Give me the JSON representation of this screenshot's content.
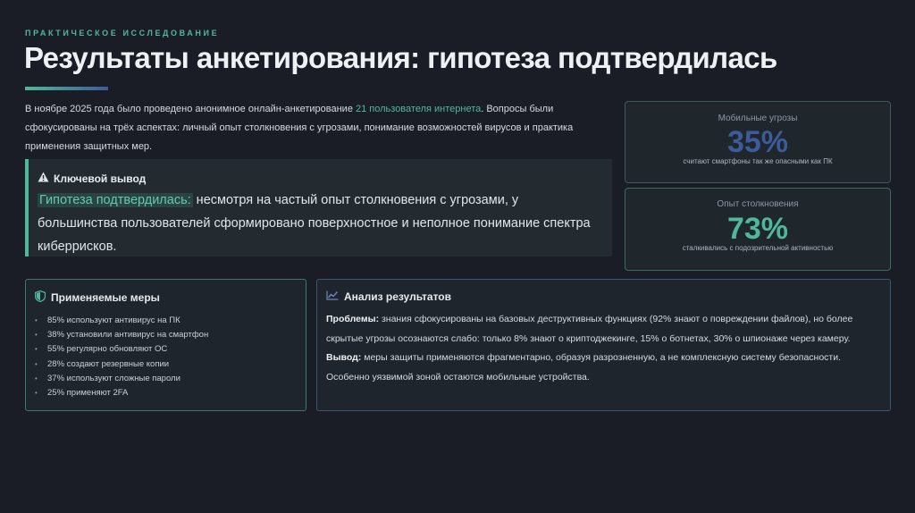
{
  "header": {
    "eyebrow": "ПРАКТИЧЕСКОЕ ИССЛЕДОВАНИЕ",
    "title": "Результаты анкетирования: гипотеза подтвердилась"
  },
  "intro": {
    "before": "В ноябре 2025 года было проведено анонимное онлайн-анкетирование ",
    "highlight": "21 пользователя интернета",
    "after": ". Вопросы были сфокусированы на трёх аспектах: личный опыт столкновения с угрозами, понимание возможностей вирусов и практика применения защитных мер."
  },
  "callout": {
    "icon": "warning-icon",
    "heading": "Ключевой вывод",
    "highlight": "Гипотеза подтвердилась:",
    "text": " несмотря на частый опыт столкновения с угрозами, у большинства пользователей сформировано поверхностное и неполное понимание спектра киберрисков."
  },
  "stats": [
    {
      "label": "Мобильные угрозы",
      "value": "35%",
      "sub": "считают смартфоны так же опасными как ПК"
    },
    {
      "label": "Опыт столкновения",
      "value": "73%",
      "sub": "сталкивались с подозрительной активностью"
    }
  ],
  "measures": {
    "icon": "shield-icon",
    "heading": "Применяемые меры",
    "items": [
      "85% используют антивирус на ПК",
      "38% установили антивирус на смартфон",
      "55% регулярно обновляют ОС",
      "28% создают резервные копии",
      "37% используют сложные пароли",
      "25% применяют 2FA"
    ]
  },
  "analysis": {
    "icon": "chart-line-icon",
    "heading": "Анализ результатов",
    "problems_label": "Проблемы:",
    "problems_text": " знания сфокусированы на базовых деструктивных функциях (92% знают о повреждении файлов), но более скрытые угрозы осознаются слабо: только 8% знают о криптоджекинге, 15% о ботнетах, 30% о шпионаже через камеру.",
    "conclusion_label": "Вывод:",
    "conclusion_text": " меры защиты применяются фрагментарно, образуя разрозненную, а не комплексную систему безопасности. Особенно уязвимой зоной остаются мобильные устройства."
  },
  "colors": {
    "accent": "#4fb89a",
    "accent2": "#3d5a9a",
    "background": "#1a1d25"
  }
}
